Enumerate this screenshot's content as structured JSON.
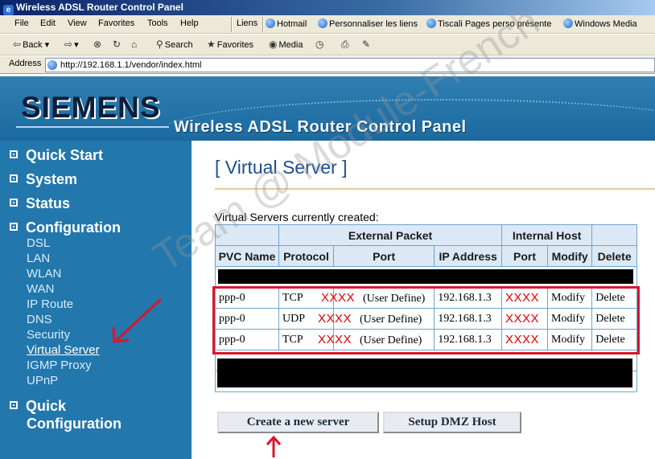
{
  "window": {
    "title": "Wireless ADSL Router Control Panel"
  },
  "menubar": {
    "items": [
      "File",
      "Edit",
      "View",
      "Favorites",
      "Tools",
      "Help"
    ],
    "links_label": "Liens",
    "links": [
      "Hotmail",
      "Personnaliser les liens",
      "Tiscali Pages perso présente",
      "Windows Media"
    ]
  },
  "toolbar": {
    "back": "Back",
    "search": "Search",
    "favorites": "Favorites",
    "media": "Media"
  },
  "address": {
    "label": "Address",
    "url": "http://192.168.1.1/vendor/index.html"
  },
  "banner": {
    "brand": "SIEMENS",
    "subtitle": "Wireless ADSL Router  Control Panel"
  },
  "sidebar": {
    "sections": [
      "Quick Start",
      "System",
      "Status",
      "Configuration"
    ],
    "config_items": [
      "DSL",
      "LAN",
      "WLAN",
      "WAN",
      "IP Route",
      "DNS",
      "Security",
      "Virtual Server",
      "IGMP Proxy",
      "UPnP"
    ],
    "active_item": "Virtual Server",
    "quick_config": [
      "Quick",
      "Configuration"
    ]
  },
  "main": {
    "title": "[ Virtual Server ]",
    "caption": "Virtual Servers currently created:",
    "table": {
      "group_headers": {
        "external": "External Packet",
        "internal": "Internal Host"
      },
      "columns": [
        "PVC Name",
        "Protocol",
        "Port",
        "IP Address",
        "Port",
        "Modify",
        "Delete"
      ],
      "rows": [
        {
          "pvc": "ppp-0",
          "protocol": "TCP",
          "port_mask": "XXXX",
          "port_type": "(User Define)",
          "ip": "192.168.1.3",
          "iport": "XXXX",
          "modify": "Modify",
          "delete": "Delete"
        },
        {
          "pvc": "ppp-0",
          "protocol": "UDP",
          "port_mask": "XXXX",
          "port_type": "(User Define)",
          "ip": "192.168.1.3",
          "iport": "XXXX",
          "modify": "Modify",
          "delete": "Delete"
        },
        {
          "pvc": "ppp-0",
          "protocol": "TCP",
          "port_mask": "XXXX",
          "port_type": "(User Define)",
          "ip": "192.168.1.3",
          "iport": "XXXX",
          "modify": "Modify",
          "delete": "Delete"
        }
      ]
    },
    "buttons": {
      "create": "Create a new server",
      "dmz": "Setup DMZ Host"
    }
  },
  "watermark": "Team @ Module-French",
  "colors": {
    "sidebar": "#2277ad",
    "title": "#1b4d8f",
    "annotation": "#d8162b"
  }
}
